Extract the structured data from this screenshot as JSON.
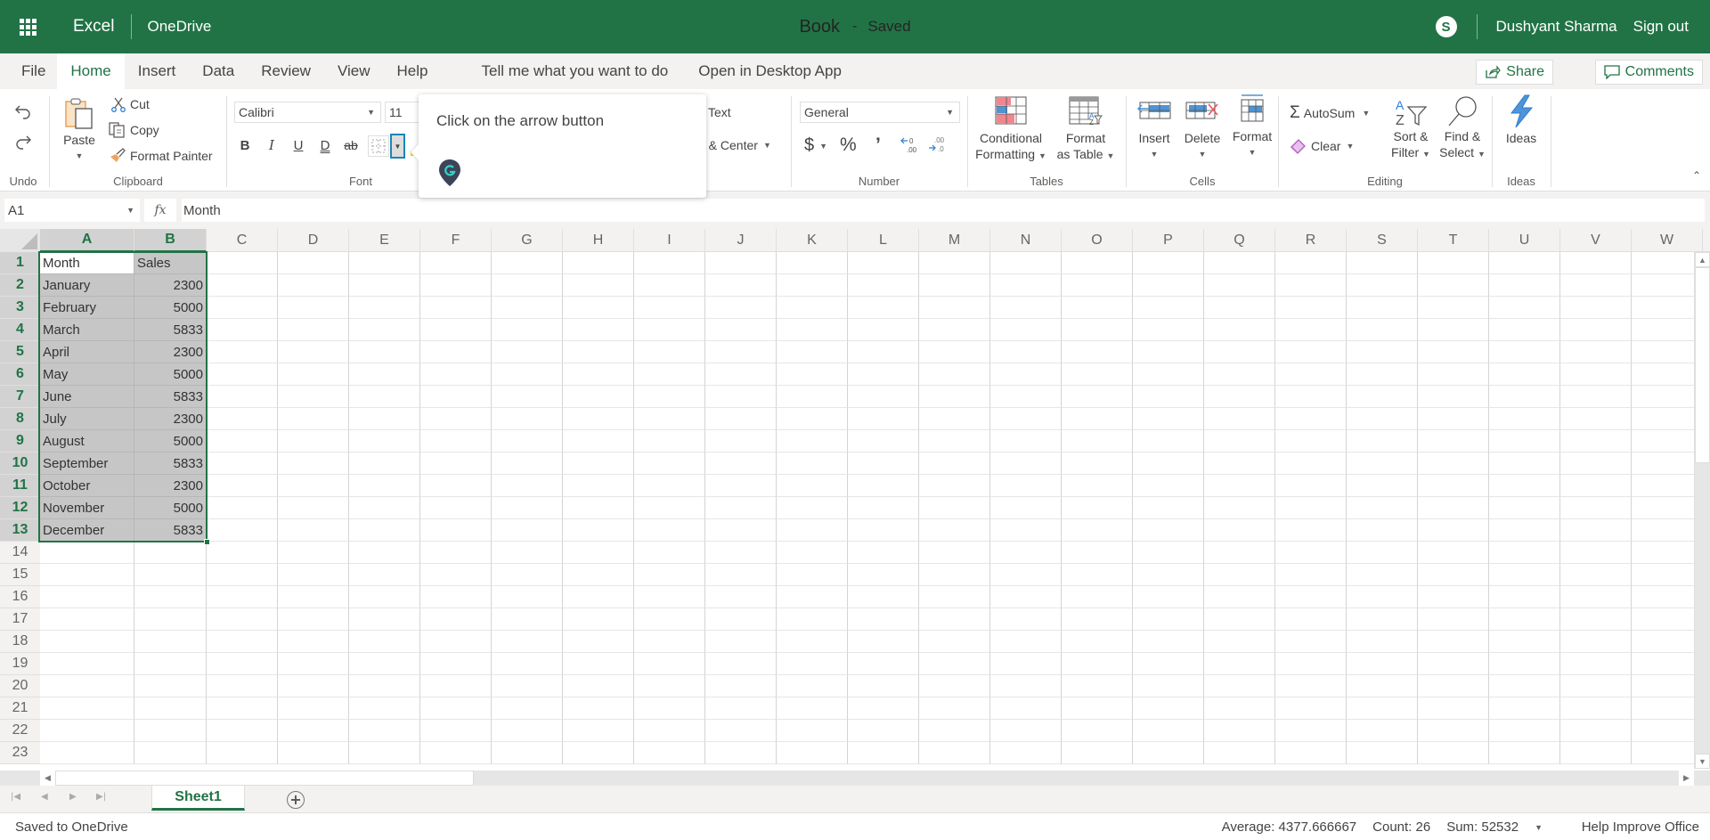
{
  "topbar": {
    "app_name": "Excel",
    "location": "OneDrive",
    "doc_title": "Book",
    "title_separator": "-",
    "save_state": "Saved",
    "user_name": "Dushyant Sharma",
    "sign_out": "Sign out",
    "brand_color": "#217346"
  },
  "menubar": {
    "tabs": [
      {
        "label": "File"
      },
      {
        "label": "Home",
        "active": true
      },
      {
        "label": "Insert"
      },
      {
        "label": "Data"
      },
      {
        "label": "Review"
      },
      {
        "label": "View"
      },
      {
        "label": "Help"
      }
    ],
    "tell_me": "Tell me what you want to do",
    "open_desktop": "Open in Desktop App",
    "share": "Share",
    "comments": "Comments"
  },
  "ribbon": {
    "undo_group": "Undo",
    "clipboard": {
      "group": "Clipboard",
      "paste": "Paste",
      "cut": "Cut",
      "copy": "Copy",
      "format_painter": "Format Painter"
    },
    "font": {
      "group": "Font",
      "font_name": "Calibri",
      "font_size": "11",
      "bold": "B",
      "italic": "I",
      "underline": "U",
      "double_underline": "D",
      "strikethrough": "ab"
    },
    "alignment": {
      "wrap_text_partial": "Text",
      "merge_partial": "e & Center"
    },
    "number": {
      "group": "Number",
      "format": "General",
      "currency": "$",
      "percent": "%",
      "comma": "9"
    },
    "tables": {
      "group": "Tables",
      "conditional_1": "Conditional",
      "conditional_2": "Formatting",
      "format_table_1": "Format",
      "format_table_2": "as Table"
    },
    "cells": {
      "group": "Cells",
      "insert": "Insert",
      "delete": "Delete",
      "format": "Format"
    },
    "editing": {
      "group": "Editing",
      "autosum": "AutoSum",
      "clear": "Clear",
      "sort_1": "Sort &",
      "sort_2": "Filter",
      "find_1": "Find &",
      "find_2": "Select"
    },
    "ideas": {
      "group": "Ideas",
      "ideas": "Ideas"
    }
  },
  "tooltip": {
    "message": "Click on the arrow button"
  },
  "formula_bar": {
    "name_box": "A1",
    "fx": "fx",
    "content": "Month"
  },
  "sheet": {
    "columns": [
      "A",
      "B",
      "C",
      "D",
      "E",
      "F",
      "G",
      "H",
      "I",
      "J",
      "K",
      "L",
      "M",
      "N",
      "O",
      "P",
      "Q",
      "R",
      "S",
      "T",
      "U",
      "V",
      "W"
    ],
    "row_count": 23,
    "data": [
      [
        "Month",
        "Sales"
      ],
      [
        "January",
        "2300"
      ],
      [
        "February",
        "5000"
      ],
      [
        "March",
        "5833"
      ],
      [
        "April",
        "2300"
      ],
      [
        "May",
        "5000"
      ],
      [
        "June",
        "5833"
      ],
      [
        "July",
        "2300"
      ],
      [
        "August",
        "5000"
      ],
      [
        "September",
        "5833"
      ],
      [
        "October",
        "2300"
      ],
      [
        "November",
        "5000"
      ],
      [
        "December",
        "5833"
      ]
    ],
    "selection": "A1:B13",
    "active_cell": "A1"
  },
  "sheet_tabs": {
    "tabs": [
      "Sheet1"
    ],
    "active": "Sheet1",
    "add_label": "+"
  },
  "status": {
    "save_status": "Saved to OneDrive",
    "average": "Average: 4377.666667",
    "count": "Count: 26",
    "sum": "Sum: 52532",
    "help": "Help Improve Office"
  }
}
